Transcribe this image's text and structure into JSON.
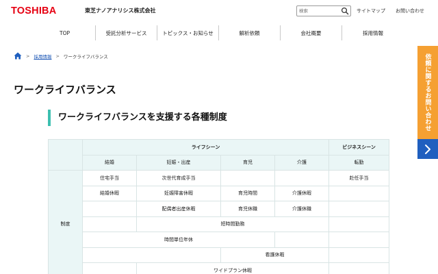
{
  "header": {
    "logo": "TOSHIBA",
    "company": "東芝ナノアナリシス株式会社",
    "search_placeholder": "検索",
    "links": [
      "サイトマップ",
      "お問い合わせ"
    ]
  },
  "nav": {
    "items": [
      "TOP",
      "受託分析サービス",
      "トピックス・お知らせ",
      "解析依頼",
      "会社概要",
      "採用情報"
    ]
  },
  "breadcrumb": {
    "items": [
      "採用情報",
      "ワークライフバランス"
    ]
  },
  "page": {
    "title": "ワークライフバランス",
    "section_title": "ワークライフバランスを支援する各種制度"
  },
  "table": {
    "group_headers": [
      "ライフシーン",
      "ビジネスシーン"
    ],
    "columns": [
      "結婚",
      "妊娠・出産",
      "育児",
      "介護",
      "転勤"
    ],
    "row_header": "制度",
    "cells": {
      "r1_kekkon": "住宅手当",
      "r1_ninshin": "次世代育成手当",
      "r1_tenkin": "赴任手当",
      "r2_kekkon": "結婚休暇",
      "r2_ninshin": "妊娠障害休暇",
      "r2_ikuji": "育児時間",
      "r2_kaigo": "介護休暇",
      "r3_ninshin": "配偶者出産休暇",
      "r3_ikuji": "育児休職",
      "r3_kaigo": "介護休職",
      "r4": "短時間勤務",
      "r5": "時間単位年休",
      "r6": "看護休暇",
      "r7": "ワイドプラン休暇"
    }
  },
  "side_tab": {
    "label": "依頼に関するお問い合わせ"
  },
  "colors": {
    "brand_red": "#e60012",
    "accent_teal": "#3dbfb0",
    "side_tab_orange": "#f5a032",
    "side_tab_blue": "#1f5fbf",
    "table_header_bg": "#eaf6f6"
  }
}
